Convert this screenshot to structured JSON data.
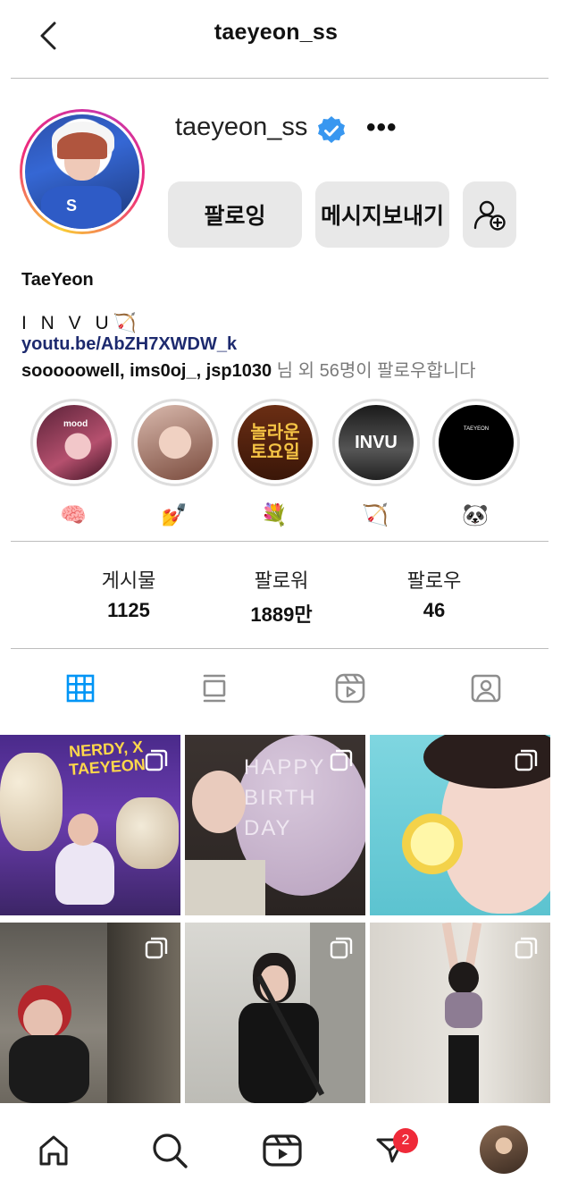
{
  "header": {
    "title": "taeyeon_ss"
  },
  "profile": {
    "username": "taeyeon_ss",
    "more_label": "•••",
    "follow_button": "팔로잉",
    "message_button": "메시지보내기",
    "display_name": "TaeYeon",
    "bio_text": "I N V U",
    "bio_link": "youtu.be/AbZH7XWDW_k",
    "followed_by_names": "sooooowell, ims0oj_, jsp1030",
    "followed_by_rest": " 님 외 56명이 팔로우합니다"
  },
  "highlights": [
    {
      "cover_text": "mood",
      "emoji": "🧠"
    },
    {
      "cover_text": "",
      "emoji": "💅"
    },
    {
      "cover_text": "놀라운 토요일",
      "emoji": "💐"
    },
    {
      "cover_text": "INVU",
      "emoji": "🏹"
    },
    {
      "cover_text": "TAEYEON",
      "emoji": "🐼"
    }
  ],
  "stats": [
    {
      "label": "게시물",
      "value": "1125"
    },
    {
      "label": "팔로워",
      "value": "1889만"
    },
    {
      "label": "팔로우",
      "value": "46"
    }
  ],
  "grid": {
    "posts": [
      {
        "overlay_text": "NERDY, X TAEYEON"
      },
      {
        "overlay_text": "HAPPY BIRTH DAY"
      },
      {
        "overlay_text": ""
      },
      {
        "overlay_text": ""
      },
      {
        "overlay_text": ""
      },
      {
        "overlay_text": ""
      }
    ]
  },
  "nav": {
    "notification_count": "2"
  },
  "colors": {
    "accent": "#0095f6",
    "verified": "#3897f0",
    "badge": "#ef2a39",
    "link": "#1d2a6e"
  },
  "icons": [
    "back-chevron-icon",
    "verified-badge-icon",
    "more-icon",
    "add-person-icon",
    "grid-icon",
    "feed-icon",
    "reels-icon",
    "tagged-icon",
    "home-icon",
    "search-icon",
    "reels-nav-icon",
    "activity-icon"
  ]
}
